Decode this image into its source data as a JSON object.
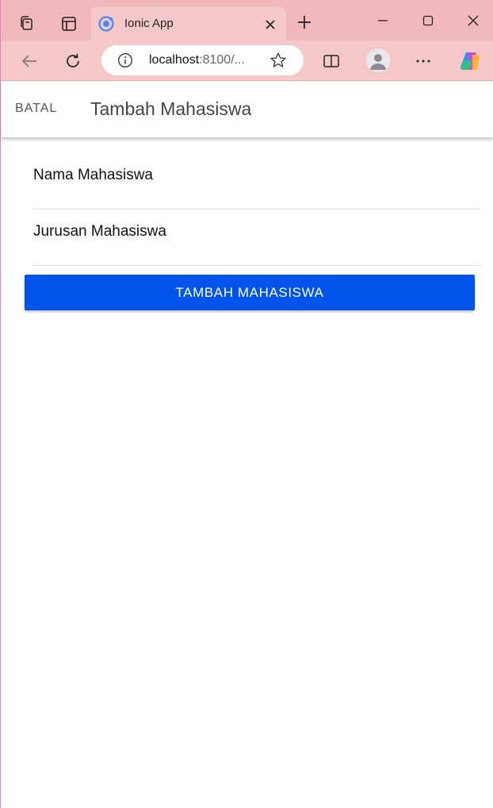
{
  "browser": {
    "tab": {
      "title": "Ionic App",
      "favicon": "ionic-logo-icon"
    },
    "address": {
      "host": "localhost",
      "rest": ":8100/..."
    },
    "icons": {
      "workspaces": "workspaces-icon",
      "tab_actions": "tab-actions-icon",
      "close_tab": "close-icon",
      "new_tab": "plus-icon",
      "minimize": "minimize-icon",
      "maximize": "maximize-icon",
      "close_window": "close-icon",
      "back": "back-arrow-icon",
      "refresh": "refresh-icon",
      "site_info": "info-icon",
      "favorite": "star-icon",
      "split_screen": "split-screen-icon",
      "profile": "profile-icon",
      "more": "more-icon",
      "copilot": "copilot-icon"
    }
  },
  "header": {
    "cancel_label": "BATAL",
    "title": "Tambah Mahasiswa"
  },
  "form": {
    "fields": [
      {
        "label": "Nama Mahasiswa",
        "value": ""
      },
      {
        "label": "Jurusan Mahasiswa",
        "value": ""
      }
    ],
    "submit_label": "TAMBAH MAHASISWA"
  },
  "colors": {
    "browser_chrome": "#f1b9bb",
    "primary_button": "#0054e9",
    "window_border": "#e97fc4"
  }
}
